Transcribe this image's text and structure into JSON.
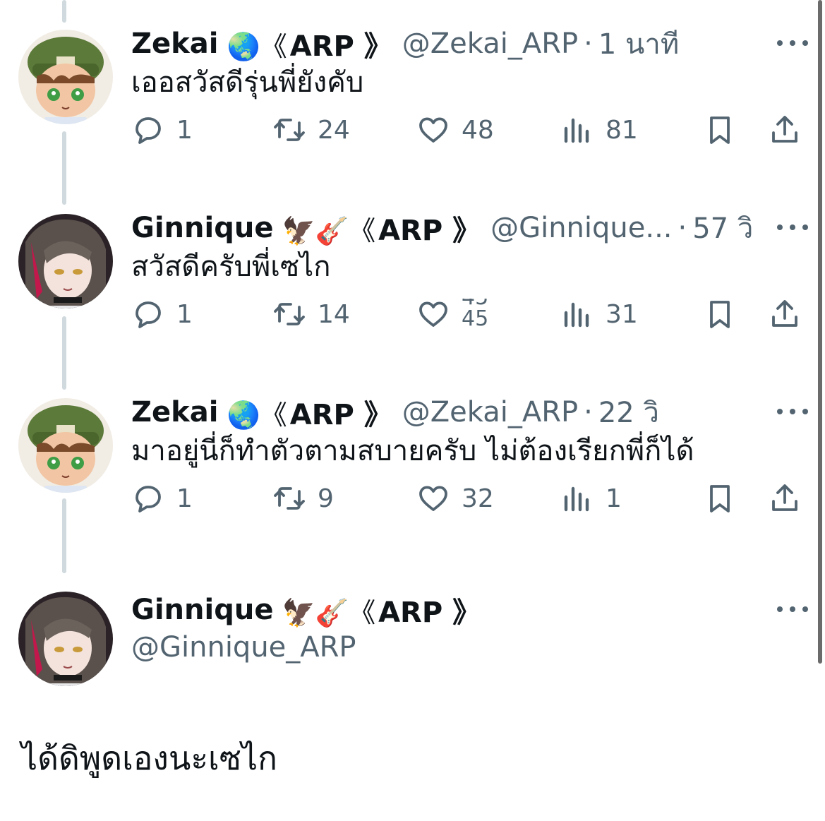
{
  "colors": {
    "text": "#0f1419",
    "secondary": "#536471",
    "thread_line": "#cfd9de",
    "background": "#ffffff"
  },
  "icons": {
    "reply": "reply-icon",
    "retweet": "retweet-icon",
    "like": "heart-icon",
    "views": "views-icon",
    "bookmark": "bookmark-icon",
    "share": "share-icon",
    "more": "more-icon"
  },
  "tweets": [
    {
      "name": "Zekai",
      "emoji": "🌏《",
      "arp": "ARP 》",
      "handle": "@Zekai_ARP",
      "time": "1 นาที",
      "text": "เออสวัสดีรุ่นพี่ยังคับ",
      "replies": "1",
      "retweets": "24",
      "likes": "48",
      "views": "81"
    },
    {
      "name": "Ginnique",
      "emoji": "🦅🎸《",
      "arp": "ARP 》",
      "handle": "@Ginnique...",
      "time": "57 วิ",
      "text": "สวัสดีครับพี่เซไก",
      "replies": "1",
      "retweets": "14",
      "likes": "45",
      "views": "31"
    },
    {
      "name": "Zekai",
      "emoji": "🌏《",
      "arp": "ARP 》",
      "handle": "@Zekai_ARP",
      "time": "22 วิ",
      "text": "มาอยู่นี่ก็ทำตัวตามสบายครับ ไม่ต้องเรียกพี่ก็ได้",
      "replies": "1",
      "retweets": "9",
      "likes": "32",
      "views": "1"
    }
  ],
  "focus": {
    "name": "Ginnique",
    "emoji": "🦅🎸《",
    "arp": "ARP 》",
    "handle": "@Ginnique_ARP",
    "text": "ได้ดิพูดเองนะเซไก"
  }
}
